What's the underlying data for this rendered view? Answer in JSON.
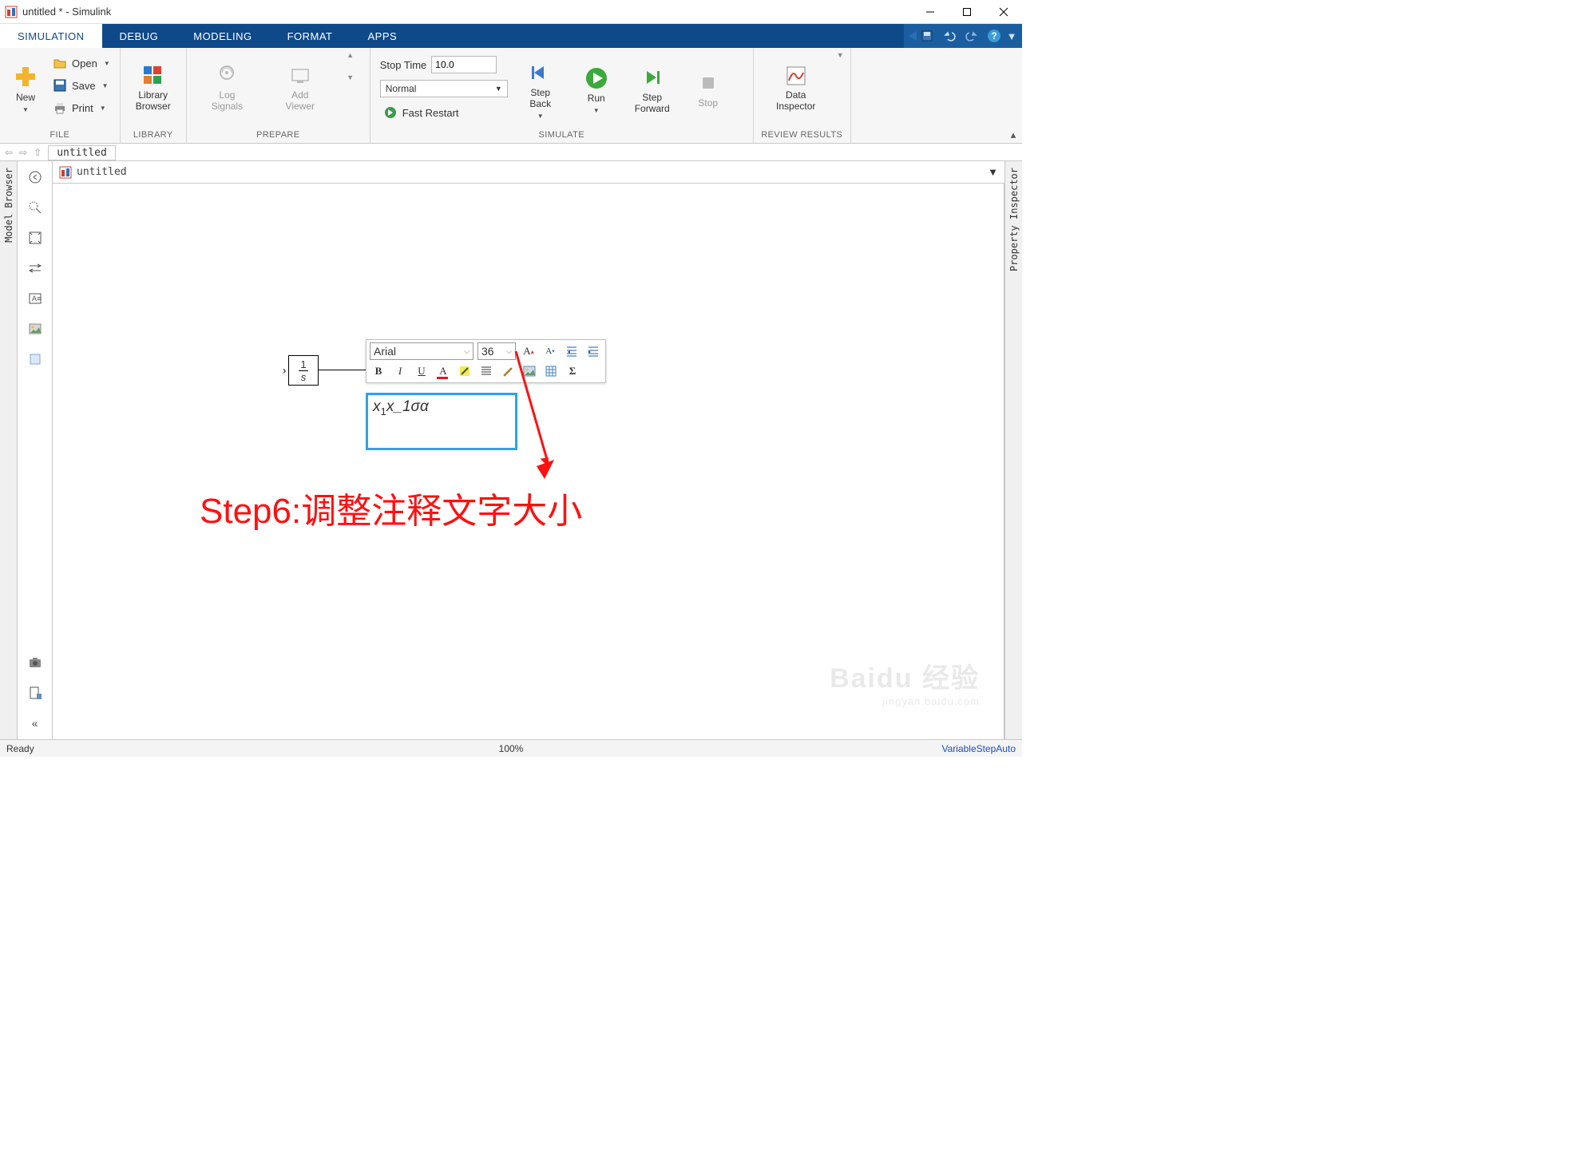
{
  "window": {
    "title": "untitled * - Simulink"
  },
  "tabs": {
    "simulation": "SIMULATION",
    "debug": "DEBUG",
    "modeling": "MODELING",
    "format": "FORMAT",
    "apps": "APPS"
  },
  "ribbon": {
    "file": {
      "new": "New",
      "open": "Open",
      "save": "Save",
      "print": "Print",
      "label": "FILE"
    },
    "library": {
      "browser": "Library\nBrowser",
      "label": "LIBRARY"
    },
    "prepare": {
      "log": "Log\nSignals",
      "add": "Add\nViewer",
      "label": "PREPARE"
    },
    "simtime": {
      "stoptime_lbl": "Stop Time",
      "stoptime_val": "10.0",
      "mode": "Normal",
      "fastrestart": "Fast Restart"
    },
    "simulate": {
      "stepback": "Step\nBack",
      "run": "Run",
      "stepfwd": "Step\nForward",
      "stop": "Stop",
      "label": "SIMULATE"
    },
    "review": {
      "data": "Data\nInspector",
      "label": "REVIEW RESULTS"
    }
  },
  "nav": {
    "tab": "untitled"
  },
  "breadcrumb": {
    "name": "untitled"
  },
  "side": {
    "left": "Model Browser",
    "right": "Property Inspector"
  },
  "fmt_toolbar": {
    "font": "Arial",
    "size": "36"
  },
  "annotation": {
    "text": "x₁x_1σα"
  },
  "stepnote": "Step6:调整注释文字大小",
  "status": {
    "left": "Ready",
    "center": "100%",
    "right": "VariableStepAuto"
  },
  "watermark": {
    "main": "Baidu 经验",
    "sub": "jingyan.baidu.com"
  }
}
